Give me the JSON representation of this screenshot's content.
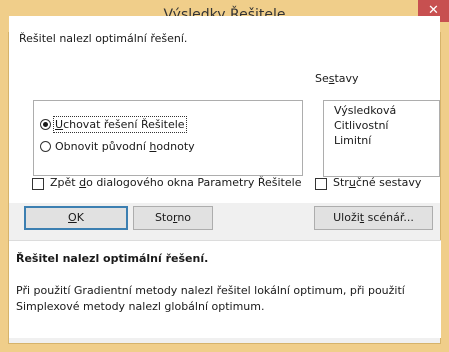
{
  "window": {
    "title": "Výsledky Řešitele",
    "close_glyph": "✕"
  },
  "result_text": "Řešitel nalezl optimální řešení.",
  "options": {
    "keep": {
      "pre": "",
      "accel": "U",
      "post": "chovat řešení Řešitele",
      "selected": true
    },
    "restore": {
      "pre": "Obnovit původní ",
      "accel": "h",
      "post": "odnoty",
      "selected": false
    }
  },
  "reports": {
    "label_pre": "Se",
    "label_accel": "s",
    "label_post": "tavy",
    "items": [
      "Výsledková",
      "Citlivostní",
      "Limitní"
    ]
  },
  "return_checkbox": {
    "pre": "Zpět ",
    "accel": "d",
    "post": "o dialogového okna Parametry Řešitele",
    "checked": false
  },
  "outline_checkbox": {
    "pre": "Str",
    "accel": "u",
    "post": "čné sestavy",
    "checked": false
  },
  "buttons": {
    "ok": {
      "pre": "",
      "accel": "O",
      "post": "K"
    },
    "cancel": {
      "pre": "Sto",
      "accel": "r",
      "post": "no"
    },
    "save": {
      "pre": "Uloži",
      "accel": "t",
      "post": " scénář..."
    }
  },
  "message": {
    "title": "Řešitel nalezl optimální řešení.",
    "body": "Při použití Gradientní metody nalezl řešitel lokální optimum, při použití Simplexové metody nalezl globální optimum."
  },
  "colors": {
    "title_bar": "#f0ce8a",
    "close_button": "#c75050",
    "dialog_bg": "#f0f0f0",
    "default_button_border": "#3c7fb1"
  }
}
